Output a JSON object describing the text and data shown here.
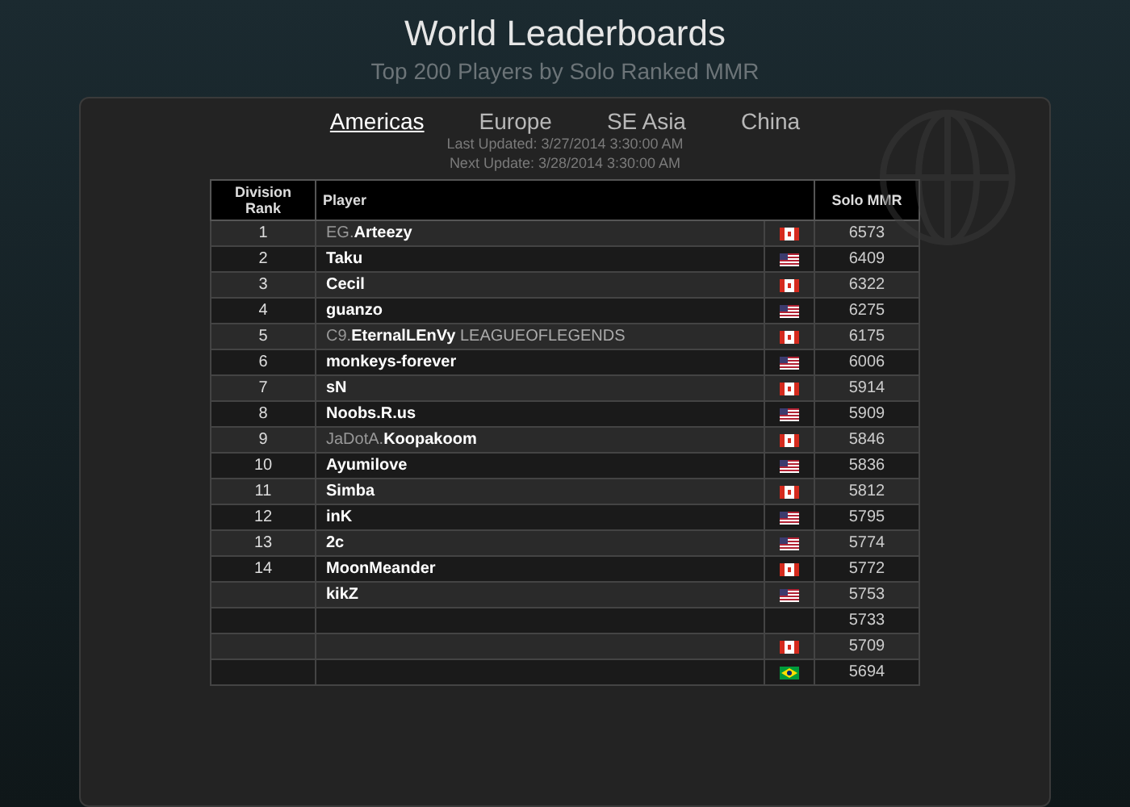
{
  "header": {
    "title": "World Leaderboards",
    "subtitle": "Top 200 Players by Solo Ranked MMR"
  },
  "tabs": [
    {
      "label": "Americas",
      "selected": true
    },
    {
      "label": "Europe",
      "selected": false
    },
    {
      "label": "SE Asia",
      "selected": false
    },
    {
      "label": "China",
      "selected": false
    }
  ],
  "updates": [
    "Last Updated: 3/27/2014 3:30:00 AM",
    "Next Update: 3/28/2014 3:30:00 AM"
  ],
  "table": {
    "columns": [
      "Division Rank",
      "Player",
      "Solo MMR"
    ],
    "rows": [
      {
        "rank": "1",
        "tag": "EG.",
        "player": "Arteezy",
        "kind": "ca",
        "mmr": "6573"
      },
      {
        "rank": "2",
        "player": "Taku",
        "kind": "us",
        "mmr": "6409"
      },
      {
        "rank": "3",
        "player": "Cecil",
        "kind": "ca",
        "mmr": "6322"
      },
      {
        "rank": "4",
        "player": "guanzo",
        "kind": "us",
        "mmr": "6275"
      },
      {
        "rank": "5",
        "tag": "C9.",
        "player": "EternalLEnVy",
        "suffix": "LEAGUEOFLEGENDS",
        "kind": "ca",
        "mmr": "6175"
      },
      {
        "rank": "6",
        "player": "monkeys-forever",
        "kind": "us",
        "mmr": "6006"
      },
      {
        "rank": "7",
        "player": "sN",
        "kind": "ca",
        "mmr": "5914"
      },
      {
        "rank": "8",
        "player": "Noobs.R.us",
        "kind": "us",
        "mmr": "5909"
      },
      {
        "rank": "9",
        "tag": "JaDotA.",
        "player": "Koopakoom",
        "kind": "ca",
        "mmr": "5846"
      },
      {
        "rank": "10",
        "player": "Ayumilove",
        "kind": "us",
        "mmr": "5836"
      },
      {
        "rank": "11",
        "player": "Simba",
        "kind": "ca",
        "mmr": "5812"
      },
      {
        "rank": "12",
        "player": "inK",
        "kind": "us",
        "mmr": "5795"
      },
      {
        "rank": "13",
        "player": "2c",
        "kind": "us",
        "mmr": "5774"
      },
      {
        "rank": "14",
        "player": "MoonMeander",
        "kind": "ca",
        "mmr": "5772"
      },
      {
        "player": "kikZ",
        "kind": "us",
        "mmr": "5753"
      },
      {
        "mmr": "5733"
      },
      {
        "kind": "ca",
        "mmr": "5709"
      },
      {
        "kind": "br",
        "mmr": "5694"
      }
    ]
  }
}
